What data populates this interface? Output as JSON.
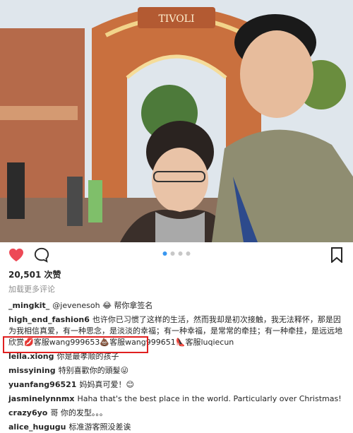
{
  "post": {
    "likes": "20,501 次赞",
    "add_comment": "加载更多评论",
    "carousel": {
      "count": 4,
      "active_index": 0
    }
  },
  "comments": [
    {
      "user": "_mingkit_",
      "text": "@jevenesoh 😂 帮你拿签名"
    },
    {
      "user": "high_end_fashion6",
      "text": "也许你已习惯了这样的生活，然而我却是初次接触，我无法释怀，那是因为我相信真爱，有一种思念，是淡淡的幸福；有一种幸福，是常常的牵挂；有一种牵挂，是远远地欣赏💋客服wang999653💩客服wang999651👠客服luqiecun"
    },
    {
      "user": "leila.xiong",
      "text": "你是最孝顺的孩子"
    },
    {
      "user": "missyining",
      "text": "特别喜歡你的頭髮😜"
    },
    {
      "user": "yuanfang96521",
      "text": "妈妈真可爱！😊"
    },
    {
      "user": "jasminelynnmx",
      "text": "Haha that's the best place in the world. Particularly over Christmas!"
    },
    {
      "user": "crazy6yo",
      "text": "哥 你的发型。。。"
    },
    {
      "user": "alice_hugugu",
      "text": "标准游客照没差诶"
    }
  ],
  "photo": {
    "gate_sign": "TIVOLI"
  },
  "colors": {
    "heart": "#ed4956",
    "highlight": "#e02020",
    "accent": "#3897f0"
  }
}
